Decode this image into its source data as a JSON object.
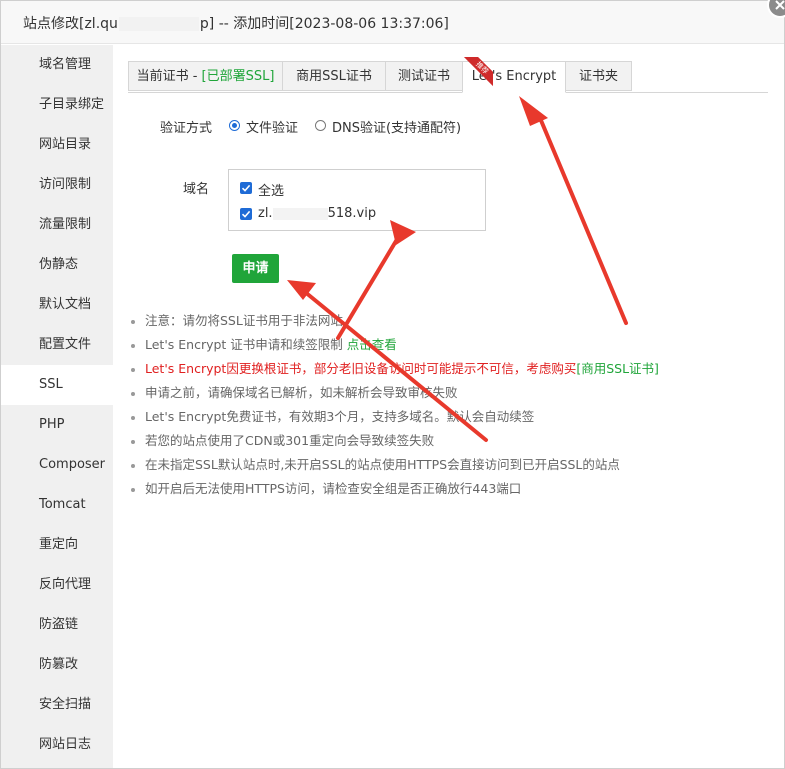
{
  "dialog": {
    "title_prefix": "站点修改[zl.qu",
    "title_suffix": "p] -- 添加时间[2023-08-06 13:37:06]"
  },
  "sidebar": {
    "items": [
      {
        "label": "域名管理"
      },
      {
        "label": "子目录绑定"
      },
      {
        "label": "网站目录"
      },
      {
        "label": "访问限制"
      },
      {
        "label": "流量限制"
      },
      {
        "label": "伪静态"
      },
      {
        "label": "默认文档"
      },
      {
        "label": "配置文件"
      },
      {
        "label": "SSL"
      },
      {
        "label": "PHP"
      },
      {
        "label": "Composer"
      },
      {
        "label": "Tomcat"
      },
      {
        "label": "重定向"
      },
      {
        "label": "反向代理"
      },
      {
        "label": "防盗链"
      },
      {
        "label": "防篡改"
      },
      {
        "label": "安全扫描"
      },
      {
        "label": "网站日志"
      }
    ],
    "active": "SSL"
  },
  "tabs": {
    "current_cert_label": "当前证书 - ",
    "current_cert_status": "[已部署SSL]",
    "commercial_label": "商用SSL证书",
    "commercial_badge": "推荐",
    "test_label": "测试证书",
    "letsencrypt_label": "Let's Encrypt",
    "folder_label": "证书夹",
    "active": "Let's Encrypt"
  },
  "form": {
    "verify_label": "验证方式",
    "verify_options": [
      {
        "label": "文件验证",
        "checked": true
      },
      {
        "label": "DNS验证(支持通配符)",
        "checked": false
      }
    ],
    "domain_label": "域名",
    "select_all_label": "全选",
    "domain_prefix": "zl.",
    "domain_suffix": "518.vip",
    "apply_label": "申请"
  },
  "notes": {
    "n1": "注意：请勿将SSL证书用于非法网站",
    "n2_text": "Let's Encrypt 证书申请和续签限制 ",
    "n2_link": "点击查看",
    "n3_text": "Let's Encrypt因更换根证书，部分老旧设备访问时可能提示不可信，考虑购买",
    "n3_link": "[商用SSL证书]",
    "n4": "申请之前，请确保域名已解析，如未解析会导致审核失败",
    "n5": "Let's Encrypt免费证书，有效期3个月，支持多域名。默认会自动续签",
    "n6": "若您的站点使用了CDN或301重定向会导致续签失败",
    "n7": "在未指定SSL默认站点时,未开启SSL的站点使用HTTPS会直接访问到已开启SSL的站点",
    "n8": "如开启后无法使用HTTPS访问，请检查安全组是否正确放行443端口"
  },
  "colors": {
    "accent_green": "#20a53a",
    "warning_red": "#e02020",
    "annotation_arrow": "#e8392c",
    "checkbox_blue": "#1e6bd6"
  }
}
